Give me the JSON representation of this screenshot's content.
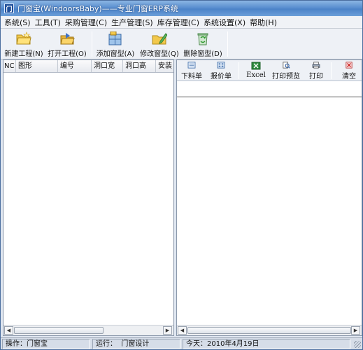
{
  "window": {
    "title": "门窗宝(WindoorsBaby)——专业门窗ERP系统",
    "icon": "app-icon",
    "icon_glyph": "门"
  },
  "menu": [
    {
      "label": "系统(S)"
    },
    {
      "label": "工具(T)"
    },
    {
      "label": "采购管理(C)"
    },
    {
      "label": "生产管理(S)"
    },
    {
      "label": "库存管理(C)"
    },
    {
      "label": "系统设置(X)"
    },
    {
      "label": "帮助(H)"
    }
  ],
  "toolbar": {
    "new_project": {
      "label": "新建工程(N)",
      "icon": "folder-new-icon"
    },
    "open_project": {
      "label": "打开工程(O)",
      "icon": "folder-open-icon"
    },
    "add_window": {
      "label": "添加窗型(A)",
      "icon": "add-window-icon"
    },
    "edit_window": {
      "label": "修改窗型(Q)",
      "icon": "edit-window-icon"
    },
    "delete_window": {
      "label": "删除窗型(D)",
      "icon": "recycle-icon"
    }
  },
  "grid": {
    "columns": [
      "NC",
      "图形",
      "编号",
      "洞口宽",
      "洞口高",
      "安装"
    ],
    "rows": []
  },
  "right_toolbar": {
    "cut_list": {
      "label": "下料单",
      "icon": "cut-list-icon"
    },
    "quote": {
      "label": "报价单",
      "icon": "quote-icon"
    },
    "excel": {
      "label": "Excel",
      "icon": "excel-icon"
    },
    "print_preview": {
      "label": "打印预览",
      "icon": "print-preview-icon"
    },
    "print": {
      "label": "打印",
      "icon": "printer-icon"
    },
    "clear": {
      "label": "清空",
      "icon": "clear-icon"
    }
  },
  "status": {
    "operator_label": "操作：",
    "operator_value": "门窗宝",
    "running_label": "运行：",
    "running_value": "门窗设计",
    "today_label": "今天：",
    "today_value": "2010年4月19日"
  },
  "colors": {
    "titlebar": "#5a8fd0",
    "workspace": "#dfe6f0",
    "panel": "#ffffff"
  }
}
